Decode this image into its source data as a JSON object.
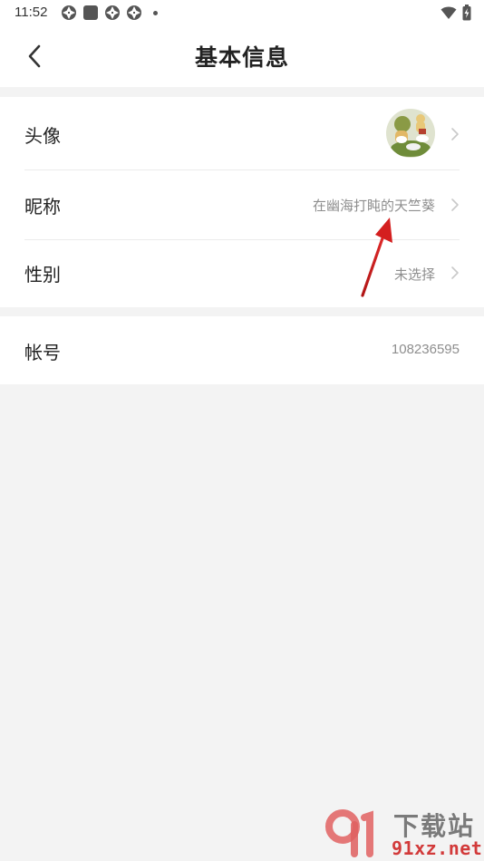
{
  "status_bar": {
    "time": "11:52",
    "left_icons": [
      "aperture-icon",
      "square-app-icon",
      "aperture-icon",
      "aperture-icon",
      "dot-icon"
    ],
    "right_icons": [
      "wifi-icon",
      "battery-charging-icon"
    ]
  },
  "header": {
    "title": "基本信息",
    "back_icon": "chevron-left-icon"
  },
  "profile": {
    "avatar_label": "头像",
    "nickname_label": "昵称",
    "nickname_value": "在幽海打盹的天竺葵",
    "gender_label": "性别",
    "gender_value": "未选择"
  },
  "account": {
    "label": "帐号",
    "value": "108236595"
  },
  "watermark": {
    "logo": "91",
    "title": "下载站",
    "domain": "91xz.net"
  },
  "colors": {
    "background": "#f3f3f3",
    "surface": "#ffffff",
    "text_primary": "#222222",
    "text_secondary": "#8e8e8e",
    "annotation_red": "#d41f1f",
    "watermark_red": "#d23a3a"
  }
}
